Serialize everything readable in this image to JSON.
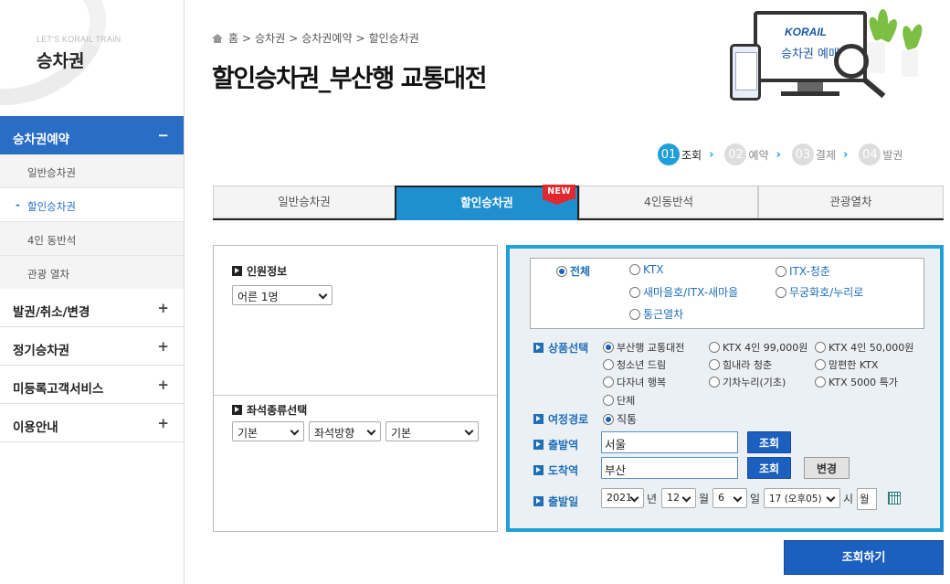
{
  "sidebar": {
    "tagline": "LET'S KORAIL TRAIN",
    "title": "승차권",
    "menu": [
      {
        "label": "승차권예약",
        "toggle": "−"
      },
      {
        "label": "발권/취소/변경",
        "toggle": "+"
      },
      {
        "label": "정기승차권",
        "toggle": "+"
      },
      {
        "label": "미등록고객서비스",
        "toggle": "+"
      },
      {
        "label": "이용안내",
        "toggle": "+"
      }
    ],
    "submenu": [
      {
        "label": "일반승차권"
      },
      {
        "label": "할인승차권",
        "marker": "-"
      },
      {
        "label": "4인 동반석"
      },
      {
        "label": "관광 열차"
      }
    ]
  },
  "breadcrumb": [
    "홈",
    "승차권",
    "승차권예약",
    "할인승차권"
  ],
  "breadcrumb_sep": ">",
  "page_title": "할인승차권_부산행 교통대전",
  "illustration": {
    "logo": "KORAIL",
    "caption": "승차권 예매"
  },
  "steps": [
    {
      "num": "01",
      "label": "조회"
    },
    {
      "num": "02",
      "label": "예약"
    },
    {
      "num": "03",
      "label": "결제"
    },
    {
      "num": "04",
      "label": "발권"
    }
  ],
  "step_arrow": "›",
  "tabs": [
    "일반승차권",
    "할인승차권",
    "4인동반석",
    "관광열차"
  ],
  "new_badge": "NEW",
  "left_panel": {
    "passenger_label": "인원정보",
    "passenger_value": "어른 1명",
    "seat_label": "좌석종류선택",
    "seat_selects": [
      "기본",
      "좌석방향",
      "기본"
    ]
  },
  "train_types": [
    "전체",
    "KTX",
    "ITX-청춘",
    "새마을호/ITX-새마을",
    "무궁화호/누리로",
    "통근열차"
  ],
  "product_label": "상품선택",
  "products": [
    "부산행 교통대전",
    "KTX 4인 99,000원",
    "KTX 4인 50,000원",
    "청소년 드림",
    "힘내라 청춘",
    "맘편한 KTX",
    "다자녀 행복",
    "기차누리(기초)",
    "KTX 5000 특가",
    "단체"
  ],
  "route_label": "여정경로",
  "route_value": "직통",
  "departure_label": "출발역",
  "departure_value": "서울",
  "arrival_label": "도착역",
  "arrival_value": "부산",
  "search_small": "조회",
  "change_label": "변경",
  "date_label": "출발일",
  "date": {
    "year": "2021",
    "year_unit": "년",
    "month": "12",
    "month_unit": "월",
    "day": "6",
    "day_unit": "일",
    "hour": "17 (오후05)",
    "hour_unit": "시",
    "weekday": "월"
  },
  "submit_label": "조회하기"
}
